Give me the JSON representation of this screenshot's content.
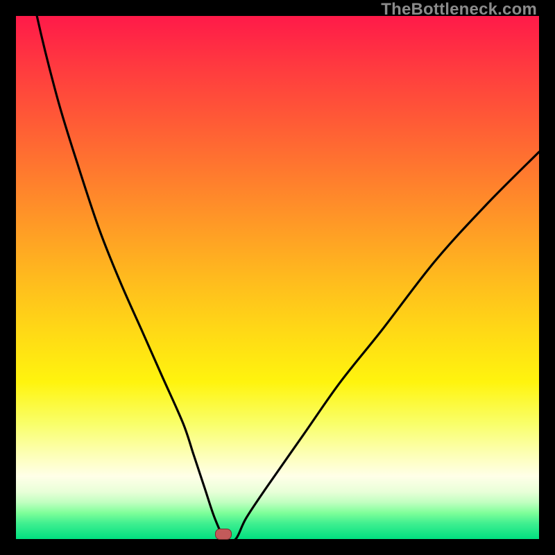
{
  "watermark": "TheBottleneck.com",
  "colors": {
    "curve_stroke": "#000000",
    "marker_fill": "#c35a5a",
    "marker_border": "#7a2e2e"
  },
  "marker": {
    "x_pct": 39.5,
    "y_pct": 99.0
  },
  "chart_data": {
    "type": "line",
    "title": "",
    "xlabel": "",
    "ylabel": "",
    "xlim": [
      0,
      100
    ],
    "ylim": [
      0,
      100
    ],
    "grid": false,
    "legend": false,
    "note": "Bottleneck-style V curve; x is hardware-balance axis (0–100), y is bottleneck percentage (0–100). Minimum at marker.",
    "series": [
      {
        "name": "bottleneck_curve",
        "x": [
          0,
          4,
          8,
          12,
          16,
          20,
          24,
          28,
          32,
          34,
          36,
          38,
          40,
          42,
          44,
          48,
          55,
          62,
          70,
          80,
          90,
          100
        ],
        "y": [
          120,
          100,
          84,
          71,
          59,
          49,
          40,
          31,
          22,
          16,
          10,
          4,
          0,
          0,
          4,
          10,
          20,
          30,
          40,
          53,
          64,
          74
        ]
      }
    ],
    "marker_point": {
      "x": 40,
      "y": 0
    }
  }
}
